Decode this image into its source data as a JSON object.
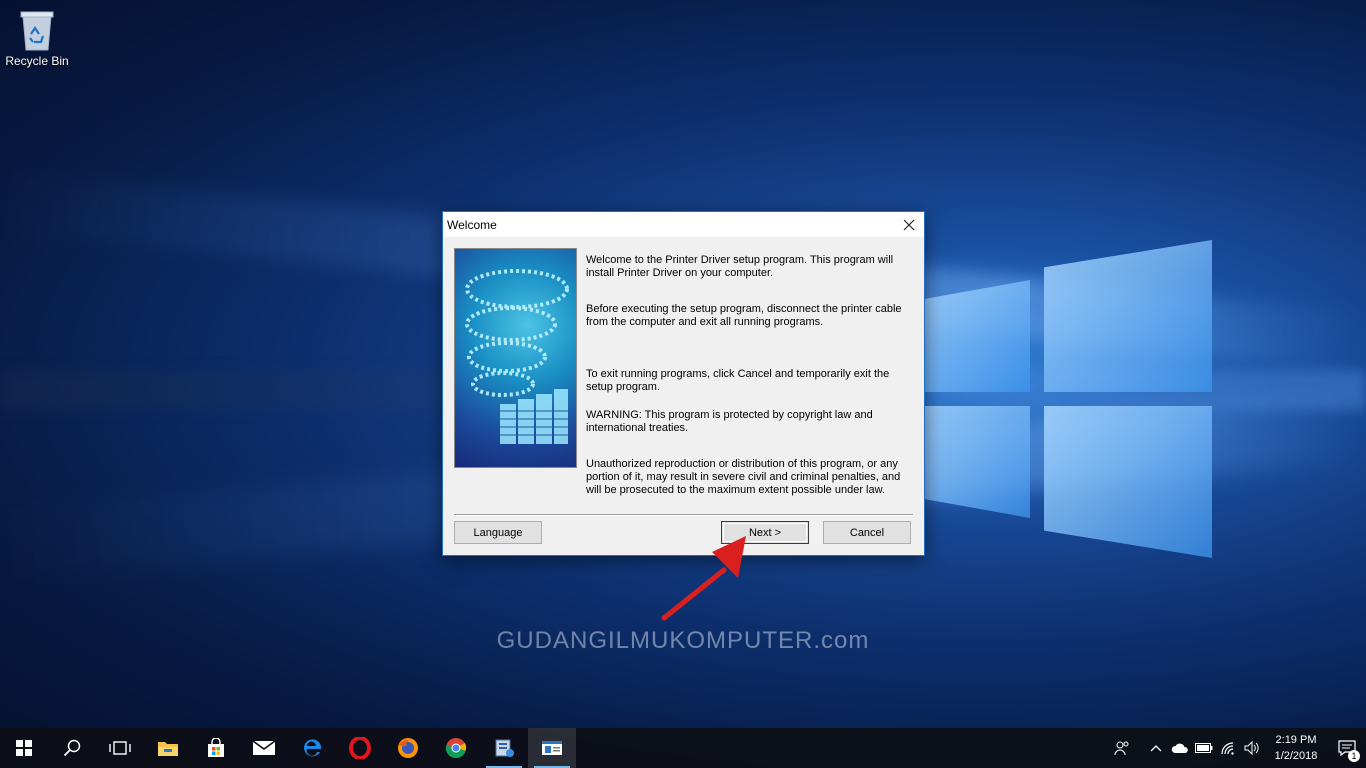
{
  "desktop": {
    "icons": [
      {
        "label": "Recycle Bin",
        "icon": "recycle-bin-icon"
      }
    ],
    "watermark": "GUDANGILMUKOMPUTER.com"
  },
  "dialog": {
    "title": "Welcome",
    "close_icon": "close-icon",
    "paragraphs": [
      "Welcome to the Printer Driver setup program. This program will install Printer Driver on your computer.",
      "Before executing the setup program, disconnect the printer cable from the computer and exit all running programs.",
      "To exit running programs, click Cancel and temporarily exit the setup program.",
      "WARNING: This program is protected by copyright law and international treaties.",
      "Unauthorized reproduction or distribution of this program, or any portion of it, may result in severe civil and criminal penalties, and will be prosecuted to the maximum extent possible under law."
    ],
    "buttons": {
      "language": "Language",
      "next": "Next >",
      "cancel": "Cancel"
    }
  },
  "taskbar": {
    "items": [
      {
        "icon": "windows-start-icon"
      },
      {
        "icon": "search-icon"
      },
      {
        "icon": "task-view-icon"
      },
      {
        "icon": "file-explorer-icon"
      },
      {
        "icon": "store-icon"
      },
      {
        "icon": "mail-icon"
      },
      {
        "icon": "edge-icon"
      },
      {
        "icon": "opera-icon"
      },
      {
        "icon": "firefox-icon"
      },
      {
        "icon": "chrome-icon"
      },
      {
        "icon": "setup-app-icon"
      },
      {
        "icon": "setup-window-icon"
      }
    ],
    "tray": {
      "icons": [
        "people-icon",
        "chevron-up-icon",
        "onedrive-icon",
        "battery-icon",
        "wifi-icon",
        "volume-icon"
      ],
      "time": "2:19 PM",
      "date": "1/2/2018",
      "notification_count": "1"
    }
  },
  "colors": {
    "dialog_border": "#1f6fc2",
    "annotation_arrow": "#d9201f",
    "taskbar": "#0c1018"
  }
}
